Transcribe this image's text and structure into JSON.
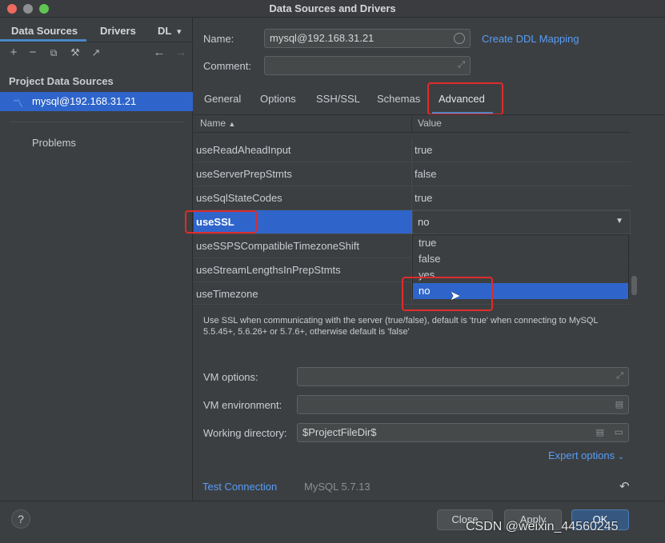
{
  "window": {
    "title": "Data Sources and Drivers"
  },
  "left_panel": {
    "tabs": [
      "Data Sources",
      "Drivers",
      "DL"
    ],
    "section_title": "Project Data Sources",
    "selected_source": "mysql@192.168.31.21",
    "problems_label": "Problems",
    "help_label": "?"
  },
  "form": {
    "name_label": "Name:",
    "name_value": "mysql@192.168.31.21",
    "create_ddl_link": "Create DDL Mapping",
    "comment_label": "Comment:",
    "comment_value": ""
  },
  "tabs": [
    {
      "label": "General"
    },
    {
      "label": "Options"
    },
    {
      "label": "SSH/SSL"
    },
    {
      "label": "Schemas"
    },
    {
      "label": "Advanced"
    }
  ],
  "table": {
    "headers": {
      "name": "Name",
      "value": "Value"
    },
    "rows": [
      {
        "name": "useReadAheadInput",
        "value": "true"
      },
      {
        "name": "useServerPrepStmts",
        "value": "false"
      },
      {
        "name": "useSqlStateCodes",
        "value": "true"
      },
      {
        "name": "useSSL",
        "value": "no"
      },
      {
        "name": "useSSPSCompatibleTimezoneShift",
        "value": ""
      },
      {
        "name": "useStreamLengthsInPrepStmts",
        "value": ""
      },
      {
        "name": "useTimezone",
        "value": ""
      }
    ],
    "dropdown_options": [
      "true",
      "false",
      "yes",
      "no"
    ],
    "dropdown_selected": "no"
  },
  "description": "Use SSL when communicating with the server (true/false), default is 'true' when connecting to MySQL 5.5.45+, 5.6.26+ or 5.7.6+, otherwise default is 'false'",
  "vm": {
    "options_label": "VM options:",
    "options_value": "",
    "environment_label": "VM environment:",
    "environment_value": "",
    "workdir_label": "Working directory:",
    "workdir_value": "$ProjectFileDir$",
    "expert_link": "Expert options"
  },
  "footer": {
    "test_connection": "Test Connection",
    "driver_version": "MySQL 5.7.13"
  },
  "buttons": {
    "close": "Close",
    "apply": "Apply",
    "ok": "OK"
  },
  "watermark": "CSDN @weixin_44560245",
  "colors": {
    "accent": "#2f65ca",
    "link": "#589df6",
    "highlight_box": "#e02b2b"
  }
}
